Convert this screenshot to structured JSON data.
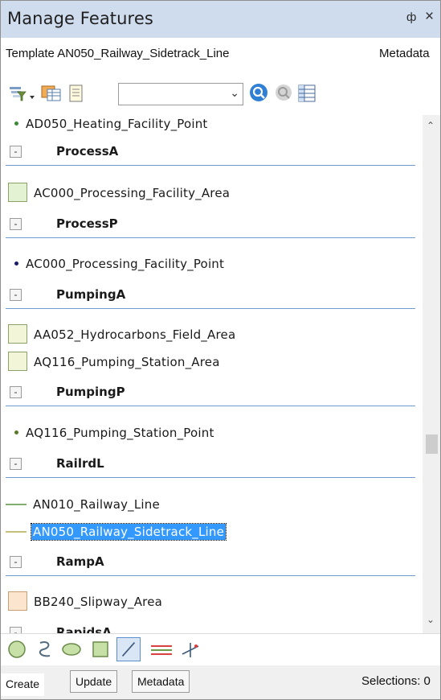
{
  "panel": {
    "title": "Manage Features",
    "pin_glyph": "ф",
    "close_glyph": "×"
  },
  "template_row": {
    "label": "Template AN050_Railway_Sidetrack_Line",
    "metadata": "Metadata"
  },
  "toolbar": {
    "icons": [
      "filter-icon",
      "table-icon",
      "notes-icon",
      "zoom-to-icon",
      "pan-to-icon",
      "attribute-table-icon"
    ],
    "combo_value": ""
  },
  "list": {
    "items": [
      {
        "kind": "point",
        "label": "AD050_Heating_Facility_Point",
        "color": "#3a8a3a"
      },
      {
        "kind": "group",
        "label": "ProcessA"
      },
      {
        "kind": "area",
        "label": "AC000_Processing_Facility_Area",
        "fill": "#e4f2d4"
      },
      {
        "kind": "group",
        "label": "ProcessP"
      },
      {
        "kind": "point",
        "label": "AC000_Processing_Facility_Point",
        "color": "#1b1b6b"
      },
      {
        "kind": "group",
        "label": "PumpingA"
      },
      {
        "kind": "area",
        "label": "AA052_Hydrocarbons_Field_Area",
        "fill": "#f2f5d8"
      },
      {
        "kind": "area",
        "label": "AQ116_Pumping_Station_Area",
        "fill": "#f2f5d8"
      },
      {
        "kind": "group",
        "label": "PumpingP"
      },
      {
        "kind": "point",
        "label": "AQ116_Pumping_Station_Point",
        "color": "#5a7a2a"
      },
      {
        "kind": "group",
        "label": "RailrdL"
      },
      {
        "kind": "line",
        "label": "AN010_Railway_Line",
        "color": "#7fae6e"
      },
      {
        "kind": "line",
        "label": "AN050_Railway_Sidetrack_Line",
        "color": "#c8c07a",
        "selected": true
      },
      {
        "kind": "group",
        "label": "RampA"
      },
      {
        "kind": "area",
        "label": "BB240_Slipway_Area",
        "fill": "#fbe5cf"
      },
      {
        "kind": "group",
        "label": "RapidsA"
      }
    ],
    "collapse_glyph": "-"
  },
  "geometry_tools": [
    "point-icon",
    "freehand-icon",
    "ellipse-icon",
    "rectangle-icon",
    "line-icon",
    "trace-icon",
    "right-angle-icon"
  ],
  "tabs": {
    "create": "Create",
    "update": "Update",
    "metadata": "Metadata",
    "selections": "Selections: 0"
  },
  "colors": {
    "titlebar": "#cfdcee",
    "selection": "#3399ff",
    "group_rule": "#6f9ad0"
  }
}
